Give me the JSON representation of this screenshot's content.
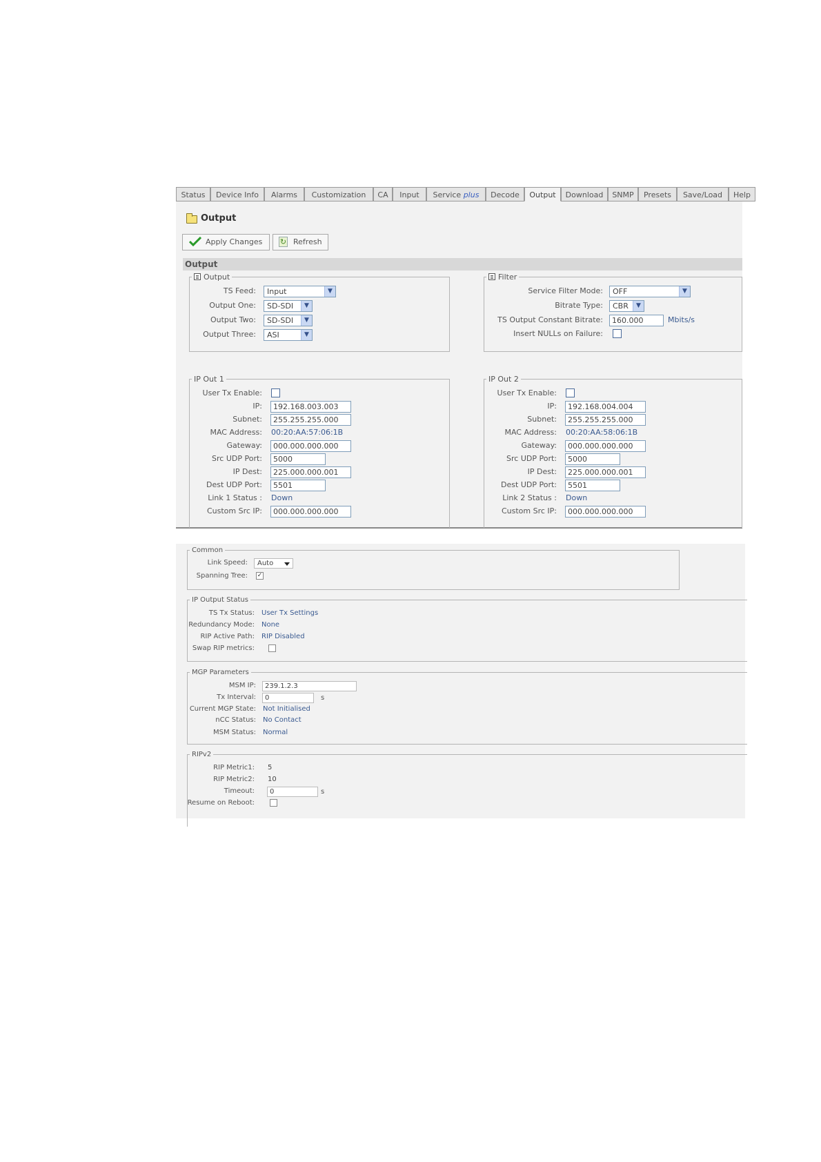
{
  "tabs": [
    {
      "label": "Status"
    },
    {
      "label": "Device Info"
    },
    {
      "label": "Alarms"
    },
    {
      "label": "Customization"
    },
    {
      "label": "CA"
    },
    {
      "label": "Input"
    },
    {
      "label": "Service",
      "suffix": "plus"
    },
    {
      "label": "Decode"
    },
    {
      "label": "Output"
    },
    {
      "label": "Download"
    },
    {
      "label": "SNMP"
    },
    {
      "label": "Presets"
    },
    {
      "label": "Save/Load"
    },
    {
      "label": "Help"
    }
  ],
  "page": {
    "title": "Output",
    "section_title": "Output"
  },
  "toolbar": {
    "apply_label": "Apply Changes",
    "refresh_label": "Refresh"
  },
  "output": {
    "legend": "Output",
    "ts_feed": {
      "label": "TS Feed:",
      "value": "Input"
    },
    "output_one": {
      "label": "Output One:",
      "value": "SD-SDI"
    },
    "output_two": {
      "label": "Output Two:",
      "value": "SD-SDI"
    },
    "output_three": {
      "label": "Output Three:",
      "value": "ASI"
    }
  },
  "filter": {
    "legend": "Filter",
    "service_filter_mode": {
      "label": "Service Filter Mode:",
      "value": "OFF"
    },
    "bitrate_type": {
      "label": "Bitrate Type:",
      "value": "CBR"
    },
    "ts_output_bitrate": {
      "label": "TS Output Constant Bitrate:",
      "value": "160.000",
      "unit": "Mbits/s"
    },
    "insert_nulls": {
      "label": "Insert NULLs on Failure:"
    }
  },
  "ip_out_1": {
    "legend": "IP Out 1",
    "user_tx_enable": "User Tx Enable:",
    "ip": {
      "label": "IP:",
      "value": "192.168.003.003"
    },
    "subnet": {
      "label": "Subnet:",
      "value": "255.255.255.000"
    },
    "mac": {
      "label": "MAC Address:",
      "value": "00:20:AA:57:06:1B"
    },
    "gateway": {
      "label": "Gateway:",
      "value": "000.000.000.000"
    },
    "src_udp": {
      "label": "Src UDP Port:",
      "value": "5000"
    },
    "ip_dest": {
      "label": "IP Dest:",
      "value": "225.000.000.001"
    },
    "dest_udp": {
      "label": "Dest UDP Port:",
      "value": "5501"
    },
    "link_status": {
      "label": "Link 1 Status :",
      "value": "Down"
    },
    "custom_src_ip": {
      "label": "Custom Src IP:",
      "value": "000.000.000.000"
    }
  },
  "ip_out_2": {
    "legend": "IP Out 2",
    "user_tx_enable": "User Tx Enable:",
    "ip": {
      "label": "IP:",
      "value": "192.168.004.004"
    },
    "subnet": {
      "label": "Subnet:",
      "value": "255.255.255.000"
    },
    "mac": {
      "label": "MAC Address:",
      "value": "00:20:AA:58:06:1B"
    },
    "gateway": {
      "label": "Gateway:",
      "value": "000.000.000.000"
    },
    "src_udp": {
      "label": "Src UDP Port:",
      "value": "5000"
    },
    "ip_dest": {
      "label": "IP Dest:",
      "value": "225.000.000.001"
    },
    "dest_udp": {
      "label": "Dest UDP Port:",
      "value": "5501"
    },
    "link_status": {
      "label": "Link 2 Status :",
      "value": "Down"
    },
    "custom_src_ip": {
      "label": "Custom Src IP:",
      "value": "000.000.000.000"
    }
  },
  "common": {
    "legend": "Common",
    "link_speed": {
      "label": "Link Speed:",
      "value": "Auto"
    },
    "spanning_tree": {
      "label": "Spanning Tree:",
      "checked": true
    }
  },
  "ip_output_status": {
    "legend": "IP Output Status",
    "ts_tx_status": {
      "label": "TS Tx Status:",
      "value": "User Tx Settings"
    },
    "redundancy_mode": {
      "label": "Redundancy Mode:",
      "value": "None"
    },
    "rip_active_path": {
      "label": "RIP Active Path:",
      "value": "RIP Disabled"
    },
    "swap_rip_metrics": {
      "label": "Swap RIP metrics:",
      "checked": false
    }
  },
  "mgp_parameters": {
    "legend": "MGP Parameters",
    "msm_ip": {
      "label": "MSM IP:",
      "value": "239.1.2.3"
    },
    "tx_interval": {
      "label": "Tx Interval:",
      "value": "0",
      "unit": "s"
    },
    "current_mgp_state": {
      "label": "Current MGP State:",
      "value": "Not Initialised"
    },
    "ncc_status": {
      "label": "nCC Status:",
      "value": "No Contact"
    },
    "msm_status": {
      "label": "MSM Status:",
      "value": "Normal"
    }
  },
  "ripv2": {
    "legend": "RIPv2",
    "rip_metric1": {
      "label": "RIP Metric1:",
      "value": "5"
    },
    "rip_metric2": {
      "label": "RIP Metric2:",
      "value": "10"
    },
    "timeout": {
      "label": "Timeout:",
      "value": "0",
      "unit": "s"
    },
    "resume_on_reboot": {
      "label": "Resume on Reboot:",
      "checked": false
    }
  },
  "colors": {
    "accent": "#3a5fc0",
    "value_text": "#3a5a90",
    "panel_bg": "#f2f2f2"
  }
}
